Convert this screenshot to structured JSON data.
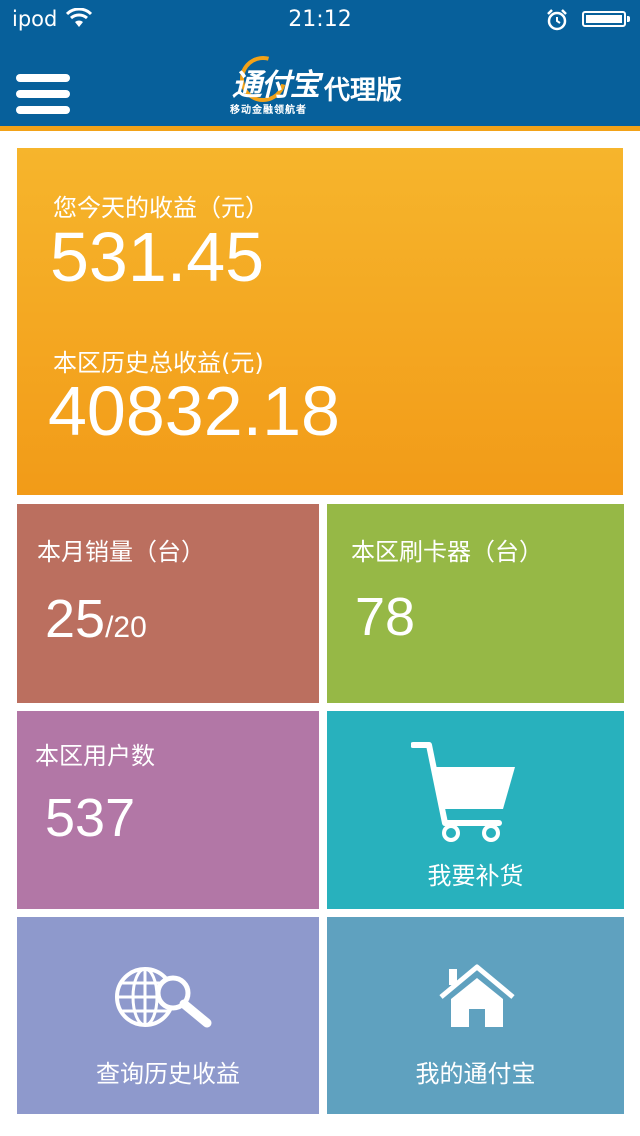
{
  "status_bar": {
    "carrier": "ipod",
    "time": "21:12"
  },
  "nav": {
    "logo_text": "通付宝",
    "logo_slogan": "移动金融领航者",
    "edition": "代理版",
    "menu_icon": "hamburger-menu-icon"
  },
  "earnings": {
    "today_label": "您今天的收益（元）",
    "today_value": "531.45",
    "total_label": "本区历史总收益(元)",
    "total_value": "40832.18"
  },
  "tiles": {
    "monthly_sales": {
      "label": "本月销量（台）",
      "value": "25",
      "target": "/20"
    },
    "card_readers": {
      "label": "本区刷卡器（台）",
      "value": "78"
    },
    "users": {
      "label": "本区用户数",
      "value": "537"
    },
    "restock": {
      "label": "我要补货",
      "icon": "shopping-cart-icon"
    },
    "history": {
      "label": "查询历史收益",
      "icon": "globe-search-icon"
    },
    "my_tfb": {
      "label": "我的通付宝",
      "icon": "home-icon"
    }
  },
  "colors": {
    "nav_bg": "#07609b",
    "accent": "#f2a218",
    "earnings_bg": "#f4a820",
    "sales_bg": "#bb6f5f",
    "readers_bg": "#96b846",
    "users_bg": "#b277a6",
    "restock_bg": "#28b1bd",
    "history_bg": "#8e99cc",
    "my_tfb_bg": "#5fa1bf"
  }
}
